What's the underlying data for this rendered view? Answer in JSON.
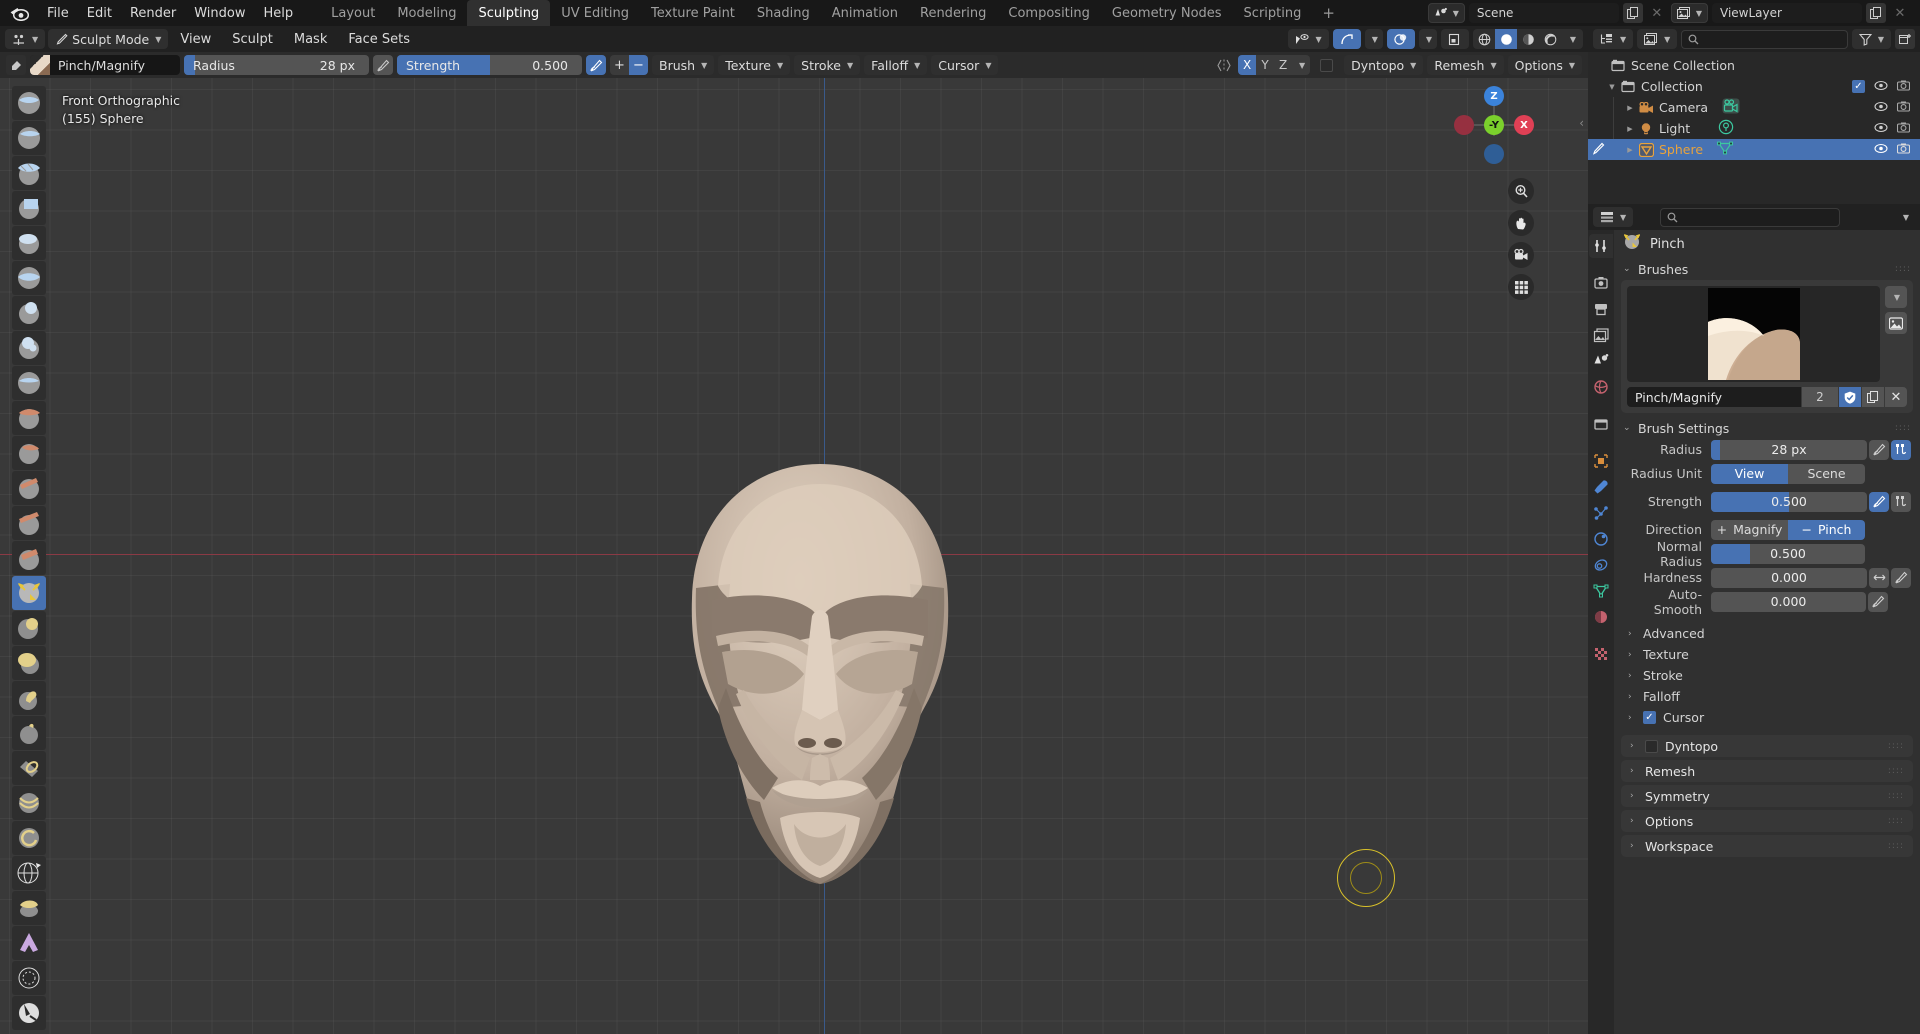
{
  "topbar": {
    "menus": [
      "File",
      "Edit",
      "Render",
      "Window",
      "Help"
    ],
    "workspaces": [
      "Layout",
      "Modeling",
      "Sculpting",
      "UV Editing",
      "Texture Paint",
      "Shading",
      "Animation",
      "Rendering",
      "Compositing",
      "Geometry Nodes",
      "Scripting"
    ],
    "active_workspace": "Sculpting",
    "plus": "+",
    "scene_name": "Scene",
    "viewlayer_name": "ViewLayer"
  },
  "viewport_header": {
    "mode": "Sculpt Mode",
    "menus": [
      "View",
      "Sculpt",
      "Mask",
      "Face Sets"
    ]
  },
  "tool_header": {
    "brush_name": "Pinch/Magnify",
    "radius_label": "Radius",
    "radius_value": "28 px",
    "radius_fill_pct": 6,
    "strength_label": "Strength",
    "strength_value": "0.500",
    "strength_fill_pct": 50,
    "plus": "+",
    "minus": "−",
    "popovers": [
      "Brush",
      "Texture",
      "Stroke",
      "Falloff",
      "Cursor"
    ],
    "symmetry_axes": [
      "X",
      "Y",
      "Z"
    ],
    "symmetry_active": "X",
    "dyntopo_label": "Dyntopo",
    "remesh_label": "Remesh",
    "options_label": "Options"
  },
  "viewport": {
    "view_name": "Front Orthographic",
    "object_info": "(155) Sphere",
    "gizmo_axes": [
      "Z",
      "X",
      "-Y"
    ],
    "cursor_color": "#d8c02a",
    "background": "#393939"
  },
  "outliner": {
    "search_placeholder": "",
    "rows": [
      {
        "label": "Scene Collection",
        "icon": "collection-icon",
        "indent": 0,
        "selected": false,
        "disclosure": "",
        "color": "#d4d4d4",
        "has_toggles": false
      },
      {
        "label": "Collection",
        "icon": "collection-icon",
        "indent": 1,
        "selected": false,
        "disclosure": "▼",
        "color": "#d4d4d4",
        "has_toggles": true,
        "has_check": true
      },
      {
        "label": "Camera",
        "icon": "camera-icon",
        "indent": 2,
        "selected": false,
        "disclosure": "▶",
        "color": "#d4d4d4",
        "has_toggles": true,
        "data_icon": "camera-data-icon"
      },
      {
        "label": "Light",
        "icon": "light-icon",
        "indent": 2,
        "selected": false,
        "disclosure": "▶",
        "color": "#d4d4d4",
        "has_toggles": true,
        "data_icon": "light-data-icon"
      },
      {
        "label": "Sphere",
        "icon": "mesh-icon",
        "indent": 2,
        "selected": true,
        "disclosure": "▶",
        "color": "#e8a33d",
        "has_toggles": true,
        "data_icon": "mesh-data-icon"
      }
    ]
  },
  "properties": {
    "breadcrumb": "Pinch",
    "brushes_panel": {
      "title": "Brushes",
      "brush_name": "Pinch/Magnify",
      "users_count": "2"
    },
    "brush_settings": {
      "title": "Brush Settings",
      "rows": [
        {
          "label": "Radius",
          "type": "slider",
          "value": "28 px",
          "fill": 6
        },
        {
          "label": "Radius Unit",
          "type": "toggle2",
          "options": [
            "View",
            "Scene"
          ],
          "active": "View"
        },
        {
          "label": "Strength",
          "type": "slider",
          "value": "0.500",
          "fill": 50
        },
        {
          "label": "Direction",
          "type": "toggle2",
          "options": [
            "Magnify",
            "Pinch"
          ],
          "active": "Pinch"
        },
        {
          "label": "Normal Radius",
          "type": "slider",
          "value": "0.500",
          "fill": 25
        },
        {
          "label": "Hardness",
          "type": "slider",
          "value": "0.000",
          "fill": 0
        },
        {
          "label": "Auto-Smooth",
          "type": "slider",
          "value": "0.000",
          "fill": 0
        }
      ],
      "subsections": [
        {
          "label": "Advanced",
          "checkbox": null
        },
        {
          "label": "Texture",
          "checkbox": null
        },
        {
          "label": "Stroke",
          "checkbox": null
        },
        {
          "label": "Falloff",
          "checkbox": null
        },
        {
          "label": "Cursor",
          "checkbox": true
        }
      ]
    },
    "panels": [
      {
        "label": "Dyntopo",
        "checkbox": false
      },
      {
        "label": "Remesh",
        "checkbox": null
      },
      {
        "label": "Symmetry",
        "checkbox": null
      },
      {
        "label": "Options",
        "checkbox": null
      },
      {
        "label": "Workspace",
        "checkbox": null
      }
    ]
  },
  "colors": {
    "accent_blue": "#4772b3",
    "orange": "#e8a33d",
    "panel_bg": "#303030",
    "header_bg": "#212121",
    "field_bg": "#545454"
  }
}
